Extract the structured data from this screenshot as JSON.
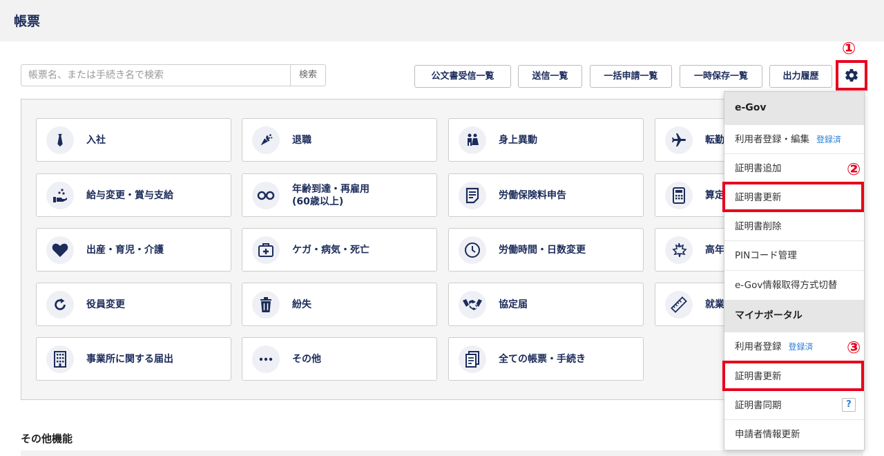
{
  "header": {
    "title": "帳票"
  },
  "search": {
    "placeholder": "帳票名、または手続き名で検索",
    "button": "検索"
  },
  "toolbar": {
    "buttons": [
      "公文書受信一覧",
      "送信一覧",
      "一括申請一覧",
      "一時保存一覧",
      "出力履歴"
    ]
  },
  "markers": {
    "one": "①",
    "two": "②",
    "three": "③"
  },
  "tiles": [
    {
      "label": "入社",
      "icon": "necktie-icon"
    },
    {
      "label": "退職",
      "icon": "bouquet-icon"
    },
    {
      "label": "身上異動",
      "icon": "wedding-couple-icon"
    },
    {
      "label": "転勤",
      "icon": "airplane-icon"
    },
    {
      "label": "給与変更・賞与支給",
      "icon": "hand-coins-icon"
    },
    {
      "label": "年齢到達・再雇用\n(60歳以上)",
      "icon": "glasses-icon"
    },
    {
      "label": "労働保険料申告",
      "icon": "document-icon"
    },
    {
      "label": "算定",
      "icon": "calculator-icon"
    },
    {
      "label": "出産・育児・介護",
      "icon": "heart-icon"
    },
    {
      "label": "ケガ・病気・死亡",
      "icon": "first-aid-icon"
    },
    {
      "label": "労働時間・日数変更",
      "icon": "clock-icon"
    },
    {
      "label": "高年",
      "icon": "maple-leaf-icon"
    },
    {
      "label": "役員変更",
      "icon": "refresh-icon"
    },
    {
      "label": "紛失",
      "icon": "trash-icon"
    },
    {
      "label": "協定届",
      "icon": "handshake-icon"
    },
    {
      "label": "就業",
      "icon": "ruler-icon"
    },
    {
      "label": "事業所に関する届出",
      "icon": "building-icon"
    },
    {
      "label": "その他",
      "icon": "more-icon"
    },
    {
      "label": "全ての帳票・手続き",
      "icon": "documents-icon"
    }
  ],
  "other_section": {
    "title": "その他機能"
  },
  "dropdown": {
    "egov_header": "e-Gov",
    "egov_items": [
      {
        "label": "利用者登録・編集",
        "badge": "登録済"
      },
      {
        "label": "証明書追加"
      },
      {
        "label": "証明書更新"
      },
      {
        "label": "証明書削除"
      },
      {
        "label": "PINコード管理"
      },
      {
        "label": "e-Gov情報取得方式切替"
      }
    ],
    "mynaportal_header": "マイナポータル",
    "mynaportal_items": [
      {
        "label": "利用者登録",
        "badge": "登録済"
      },
      {
        "label": "証明書更新"
      },
      {
        "label": "証明書同期",
        "help": "?"
      },
      {
        "label": "申請者情報更新"
      }
    ]
  },
  "colors": {
    "navy": "#1b2b5a",
    "accent_red": "#e8001c",
    "link_blue": "#2a7fd4"
  }
}
